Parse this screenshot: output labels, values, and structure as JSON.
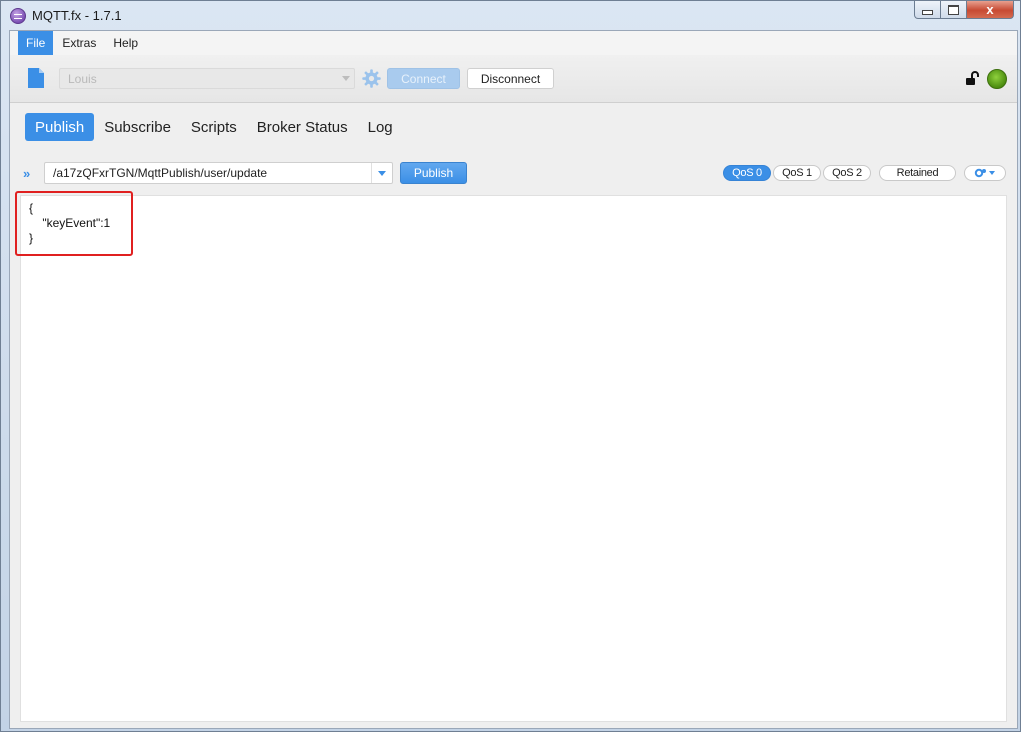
{
  "window": {
    "title": "MQTT.fx - 1.7.1",
    "close_glyph": "x"
  },
  "menubar": {
    "items": [
      "File",
      "Extras",
      "Help"
    ]
  },
  "toolbar": {
    "profile": "Louis",
    "connect_label": "Connect",
    "disconnect_label": "Disconnect",
    "status_color": "#5aa81a"
  },
  "tabs": [
    "Publish",
    "Subscribe",
    "Scripts",
    "Broker Status",
    "Log"
  ],
  "publish": {
    "topic": "/a17zQFxrTGN/MqttPublish/user/update",
    "publish_label": "Publish",
    "qos": [
      "QoS 0",
      "QoS 1",
      "QoS 2"
    ],
    "retained_label": "Retained",
    "payload_lines": [
      "{",
      "    \"keyEvent\":1",
      "}"
    ]
  },
  "colors": {
    "accent": "#3b8fe6",
    "highlight": "#e02020"
  }
}
